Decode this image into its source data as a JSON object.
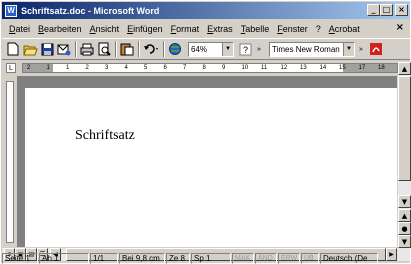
{
  "window": {
    "title": "Schriftsatz.doc - Microsoft Word",
    "app_icon": "W"
  },
  "menu": {
    "items": [
      "Datei",
      "Bearbeiten",
      "Ansicht",
      "Einfügen",
      "Format",
      "Extras",
      "Tabelle",
      "Fenster",
      "?",
      "Acrobat"
    ],
    "close_glyph": "×"
  },
  "toolbar": {
    "icons": [
      "new-document-icon",
      "open-folder-icon",
      "save-icon",
      "email-icon",
      "print-icon",
      "print-preview-icon",
      "paste-icon",
      "undo-icon",
      "insert-table-icon"
    ],
    "zoom": "64%",
    "help_glyph": "?",
    "font_name": "Times New Roman",
    "acrobat_icon": "pdf-icon"
  },
  "ruler": {
    "ticks": [
      "2",
      "1",
      "1",
      "2",
      "3",
      "4",
      "5",
      "6",
      "7",
      "8",
      "9",
      "10",
      "11",
      "12",
      "13",
      "14",
      "15",
      "17",
      "18"
    ]
  },
  "document": {
    "text": "Schriftsatz"
  },
  "status": {
    "page": "Seite 1",
    "section": "Ab 1",
    "pages": "1/1",
    "position": "Bei 9,8 cm",
    "line": "Ze 8",
    "column": "Sp 1",
    "mak": "MAK",
    "aend": "ÄND",
    "erw": "ERW",
    "ub": "ÜB",
    "language": "Deutsch (De"
  },
  "colors": {
    "title_start": "#0a246a",
    "title_end": "#a6caf0",
    "chrome": "#d4d0c8",
    "workspace": "#808080"
  }
}
